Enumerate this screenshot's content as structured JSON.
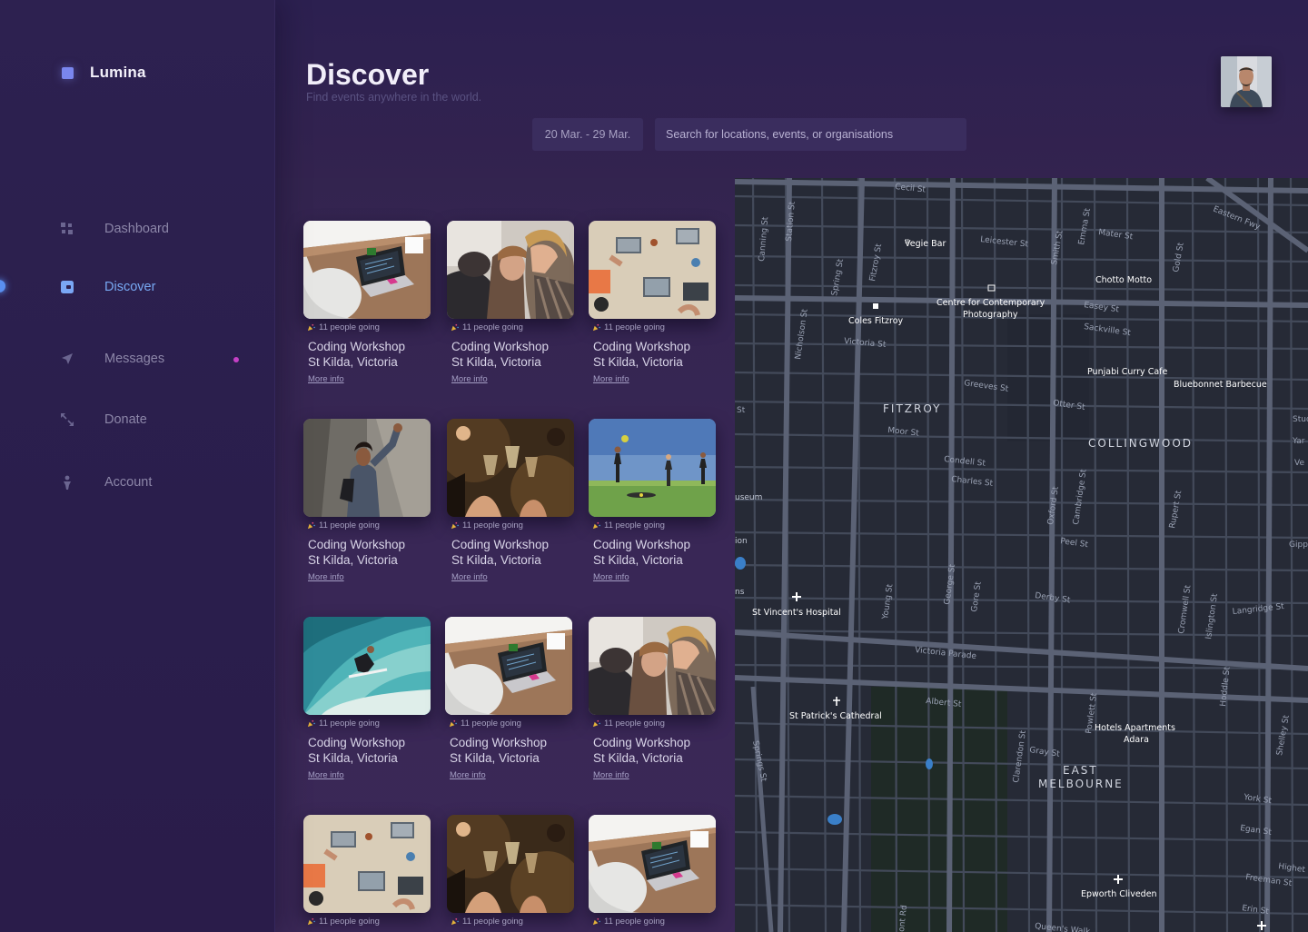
{
  "app": {
    "name": "Lumina"
  },
  "sidebar": {
    "items": [
      {
        "label": "Dashboard",
        "icon": "grid-icon",
        "active": false
      },
      {
        "label": "Discover",
        "icon": "compass-icon",
        "active": true
      },
      {
        "label": "Messages",
        "icon": "send-icon",
        "active": false,
        "has_unread": true
      },
      {
        "label": "Donate",
        "icon": "arrows-icon",
        "active": false
      },
      {
        "label": "Account",
        "icon": "person-icon",
        "active": false
      }
    ]
  },
  "header": {
    "title": "Discover",
    "subtitle": "Find events anywhere in the world.",
    "date_range": "20 Mar. - 29 Mar.",
    "search_placeholder": "Search for locations, events, or organisations"
  },
  "events": [
    {
      "going": "11 people going",
      "title": "Coding Workshop",
      "location": "St Kilda, Victoria",
      "more": "More info",
      "image": "laptop-desk"
    },
    {
      "going": "11 people going",
      "title": "Coding Workshop",
      "location": "St Kilda, Victoria",
      "more": "More info",
      "image": "women-laughing"
    },
    {
      "going": "11 people going",
      "title": "Coding Workshop",
      "location": "St Kilda, Victoria",
      "more": "More info",
      "image": "team-laptops"
    },
    {
      "going": "11 people going",
      "title": "Coding Workshop",
      "location": "St Kilda, Victoria",
      "more": "More info",
      "image": "woman-wall"
    },
    {
      "going": "11 people going",
      "title": "Coding Workshop",
      "location": "St Kilda, Victoria",
      "more": "More info",
      "image": "cheers"
    },
    {
      "going": "11 people going",
      "title": "Coding Workshop",
      "location": "St Kilda, Victoria",
      "more": "More info",
      "image": "field-game"
    },
    {
      "going": "11 people going",
      "title": "Coding Workshop",
      "location": "St Kilda, Victoria",
      "more": "More info",
      "image": "surfer"
    },
    {
      "going": "11 people going",
      "title": "Coding Workshop",
      "location": "St Kilda, Victoria",
      "more": "More info",
      "image": "laptop-desk"
    },
    {
      "going": "11 people going",
      "title": "Coding Workshop",
      "location": "St Kilda, Victoria",
      "more": "More info",
      "image": "women-laughing"
    },
    {
      "going": "11 people going",
      "title": "Coding Workshop",
      "location": "St Kilda, Victoria",
      "more": "More info",
      "image": "team-laptops"
    },
    {
      "going": "11 people going",
      "title": "",
      "location": "",
      "more": "",
      "image": "cheers"
    },
    {
      "going": "11 people going",
      "title": "",
      "location": "",
      "more": "",
      "image": "laptop-desk"
    }
  ],
  "map": {
    "suburbs": [
      "FITZROY",
      "COLLINGWOOD",
      "EAST",
      "MELBOURNE"
    ],
    "places": [
      "Vegie Bar",
      "Centre for Contemporary",
      "Photography",
      "Chotto Motto",
      "Coles Fitzroy",
      "Punjabi Curry Cafe",
      "Bluebonnet Barbecue",
      "St Vincent's Hospital",
      "St Patrick's Cathedral",
      "Hotels Apartments",
      "Adara",
      "Epworth Cliveden"
    ],
    "streets": [
      "Cecil St",
      "Leicester St",
      "Smith St",
      "Emma St",
      "Mater St",
      "Eastern Fwy",
      "Gold St",
      "Canning St",
      "Station St",
      "Spring St",
      "Fitzroy St",
      "Easey St",
      "Sackville St",
      "Nicholson St",
      "Victoria St",
      "Greeves St",
      "Otter St",
      "Moor St",
      "Condell St",
      "Charles St",
      "Oxford St",
      "Cambridge St",
      "Rupert St",
      "Peel St",
      "Derby St",
      "Young St",
      "George St",
      "Gore St",
      "Cromwell St",
      "Islington St",
      "Langridge St",
      "Victoria Parade",
      "Albert St",
      "Clarendon St",
      "Gray St",
      "Powlett St",
      "Hoddle St",
      "Shelley St",
      "York St",
      "Egan St",
      "Highet",
      "Freeman St",
      "Erin St",
      "Queen's Walk",
      "Studl",
      "Yar",
      "Ve",
      "Gipp",
      "St",
      "useum",
      "ion",
      "ns",
      "Springs St",
      "ont Rd"
    ]
  }
}
